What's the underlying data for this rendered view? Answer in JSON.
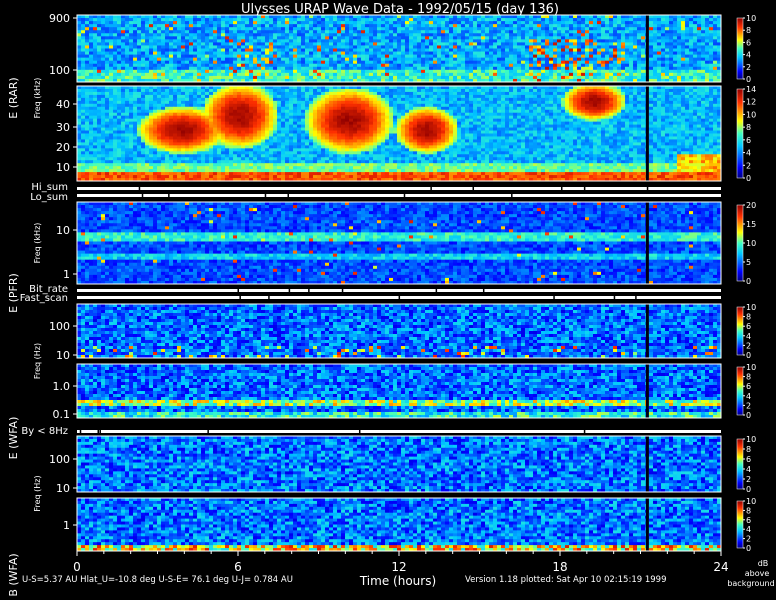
{
  "title": "Ulysses URAP Wave Data - 1992/05/15  (day 136)",
  "footer": {
    "orbit_info": "U-S=5.37 AU  Hlat_U=-10.8 deg   U-S-E= 76.1 deg  U-J= 0.784 AU",
    "version_info": "Version 1.18 plotted: Sat Apr 10 02:15:19 1999",
    "colorbar_units_line1": "dB",
    "colorbar_units_line2": "above",
    "colorbar_units_line3": "background"
  },
  "chart_data": {
    "type": "heatmap",
    "x": {
      "label": "Time (hours)",
      "range": [
        0,
        24
      ],
      "ticks": [
        "0",
        "6",
        "12",
        "18",
        "24"
      ]
    },
    "flag_labels": [
      "Hi_sum",
      "Lo_sum",
      "Bit_rate",
      "Fast_scan",
      "By < 8Hz"
    ],
    "groups": [
      {
        "name": "E (RAR)",
        "freq_label": "Freq (kHz)"
      },
      {
        "name": "E (PFR)",
        "freq_label": "Freq (kHz)"
      },
      {
        "name": "E (WFA)",
        "freq_label": "Freq (Hz)"
      },
      {
        "name": "B (WFA)",
        "freq_label": "Freq (Hz)"
      }
    ],
    "panels": [
      {
        "id": "rar_high",
        "y_ticks": [
          "900",
          "100"
        ],
        "colorbar_ticks": [
          "10",
          "8",
          "6",
          "4",
          "2",
          "0"
        ],
        "cmax": 10
      },
      {
        "id": "rar_low",
        "y_ticks": [
          "40",
          "30",
          "20",
          "10"
        ],
        "colorbar_ticks": [
          "14",
          "12",
          "10",
          "8",
          "6",
          "4",
          "2",
          "0"
        ],
        "cmax": 14
      },
      {
        "id": "pfr",
        "y_ticks": [
          "10",
          "1"
        ],
        "colorbar_ticks": [
          "20",
          "15",
          "10",
          "5",
          "0"
        ],
        "cmax": 20
      },
      {
        "id": "wfa_e_high",
        "y_ticks": [
          "100",
          "10"
        ],
        "colorbar_ticks": [
          "10",
          "8",
          "6",
          "4",
          "2",
          "0"
        ],
        "cmax": 10
      },
      {
        "id": "wfa_e_low",
        "y_ticks": [
          "1.0",
          "0.1"
        ],
        "colorbar_ticks": [
          "10",
          "8",
          "6",
          "4",
          "2",
          "0"
        ],
        "cmax": 10
      },
      {
        "id": "wfa_b_high",
        "y_ticks": [
          "100",
          "10"
        ],
        "colorbar_ticks": [
          "10",
          "8",
          "6",
          "4",
          "2",
          "0"
        ],
        "cmax": 10
      },
      {
        "id": "wfa_b_low",
        "y_ticks": [
          "1"
        ],
        "colorbar_ticks": [
          "10",
          "8",
          "6",
          "4",
          "2",
          "0"
        ],
        "cmax": 10
      }
    ]
  }
}
